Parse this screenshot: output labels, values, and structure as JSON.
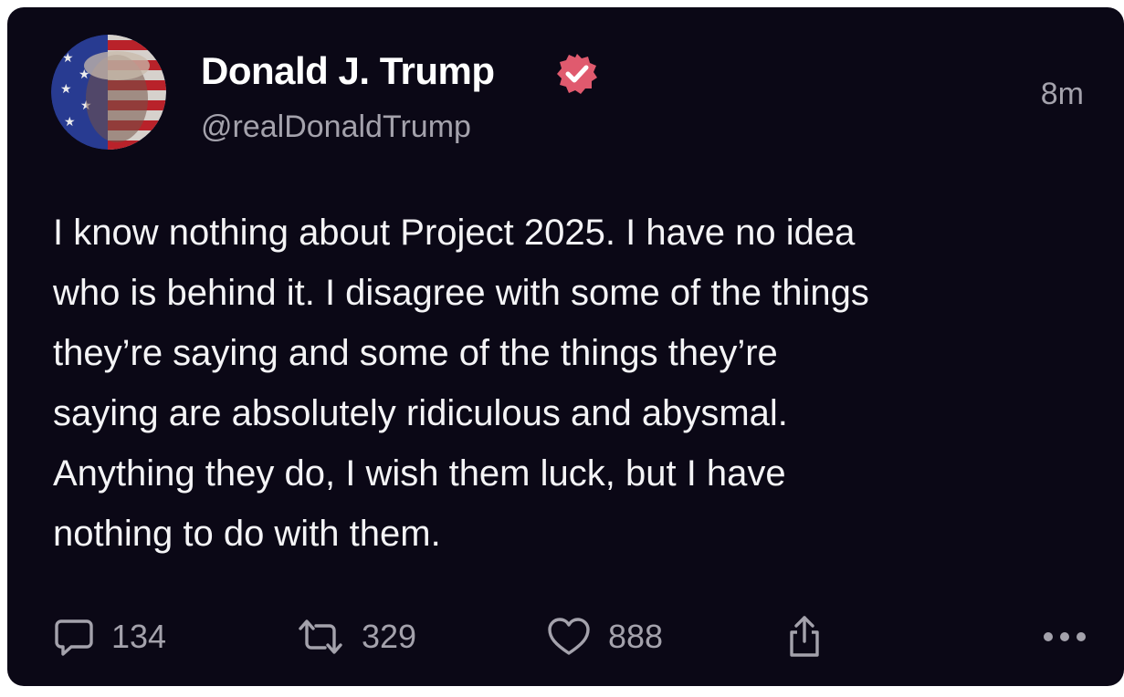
{
  "post": {
    "author": {
      "display_name": "Donald J. Trump",
      "handle": "@realDonaldTrump",
      "verified": true,
      "avatar": "flag-painted-portrait"
    },
    "timestamp": "8m",
    "text_lines": [
      "I know nothing about Project 2025. I have no idea",
      "who is behind it. I disagree with some of the things",
      "they’re saying and some of the things they’re",
      "saying are absolutely ridiculous and abysmal.",
      "Anything they do, I wish them luck, but I have",
      "nothing to do with them."
    ],
    "stats": {
      "replies": "134",
      "reposts": "329",
      "likes": "888"
    }
  },
  "icons": {
    "reply": "speech-bubble-icon",
    "repost": "repost-arrows-icon",
    "like": "heart-icon",
    "share": "share-icon",
    "more": "more-dots-icon",
    "verified": "verified-badge-icon"
  },
  "colors": {
    "background": "#0b0816",
    "text": "#f4f4f6",
    "muted": "#a4a2ac",
    "verified_badge": "#e05a6e"
  }
}
